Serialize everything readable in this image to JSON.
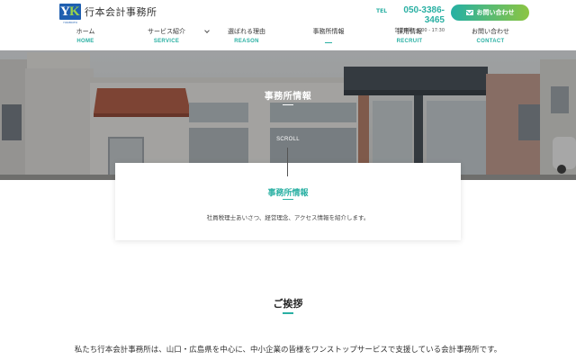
{
  "header": {
    "logo_mark_y": "Y",
    "logo_mark_k": "K",
    "logo_mark_small": "YUKIMOTO",
    "logo_text": "行本会計事務所",
    "tel_label": "TEL",
    "tel_number": "050-3386-3465",
    "tel_hours": "営業時間：9:00 - 17:30",
    "contact_button": "お問い合わせ"
  },
  "nav": [
    {
      "jp": "ホーム",
      "en": "HOME"
    },
    {
      "jp": "サービス紹介",
      "en": "SERVICE"
    },
    {
      "jp": "選ばれる理由",
      "en": "REASON"
    },
    {
      "jp": "事務所情報",
      "en": ""
    },
    {
      "jp": "採用情報",
      "en": "RECRUIT"
    },
    {
      "jp": "お問い合わせ",
      "en": "CONTACT"
    }
  ],
  "hero": {
    "title": "事務所情報",
    "scroll": "SCROLL"
  },
  "intro": {
    "title": "事務所情報",
    "text": "社員税理士あいさつ、経営理念、アクセス情報を紹介します。"
  },
  "greeting": {
    "title": "ご挨拶",
    "text": "私たち行本会計事務所は、山口・広島県を中心に、中小企業の皆様をワンストップサービスで支援している会計事務所です。"
  },
  "colors": {
    "accent": "#2ab0a3",
    "accent_green": "#8cc542",
    "logo_blue": "#1f5fb0"
  }
}
